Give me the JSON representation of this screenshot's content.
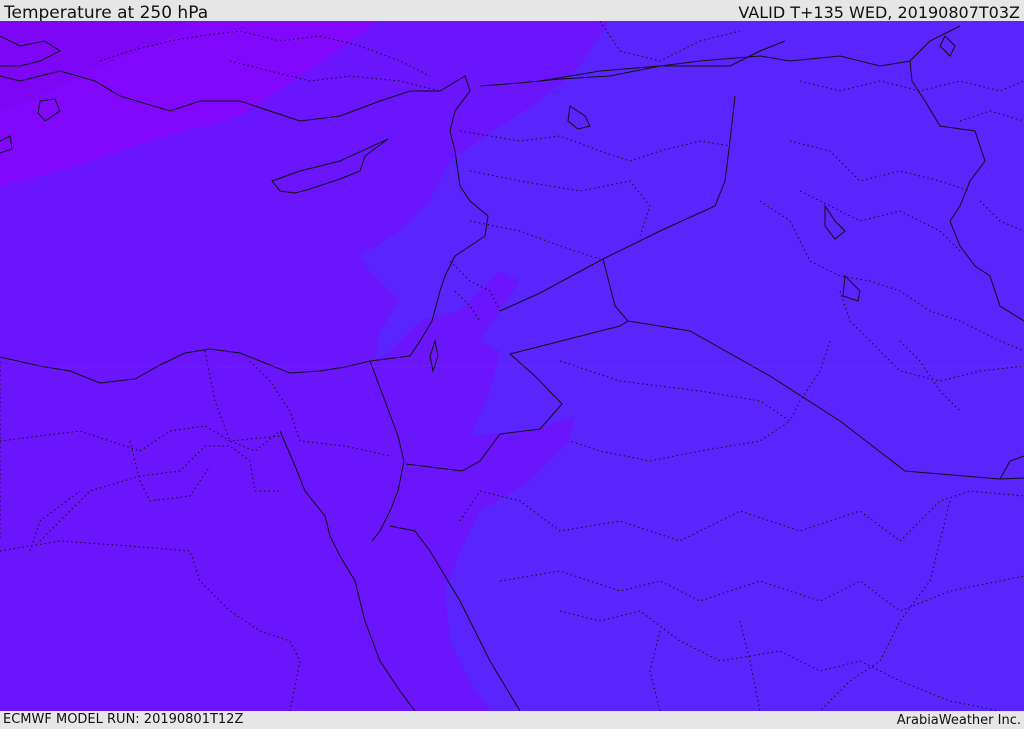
{
  "header": {
    "title": "Temperature at 250 hPa",
    "valid_time": "VALID T+135 WED, 20190807T03Z"
  },
  "footer": {
    "model_run": "ECMWF MODEL RUN: 20190801T12Z",
    "credit": "ArabiaWeather Inc."
  },
  "colors": {
    "warmest_band": "#7d07f4",
    "warm_band": "#8207fd",
    "mid_band": "#6a15fb",
    "cool_band": "#5a24fd",
    "coast_and_border_lines": "#111111"
  }
}
